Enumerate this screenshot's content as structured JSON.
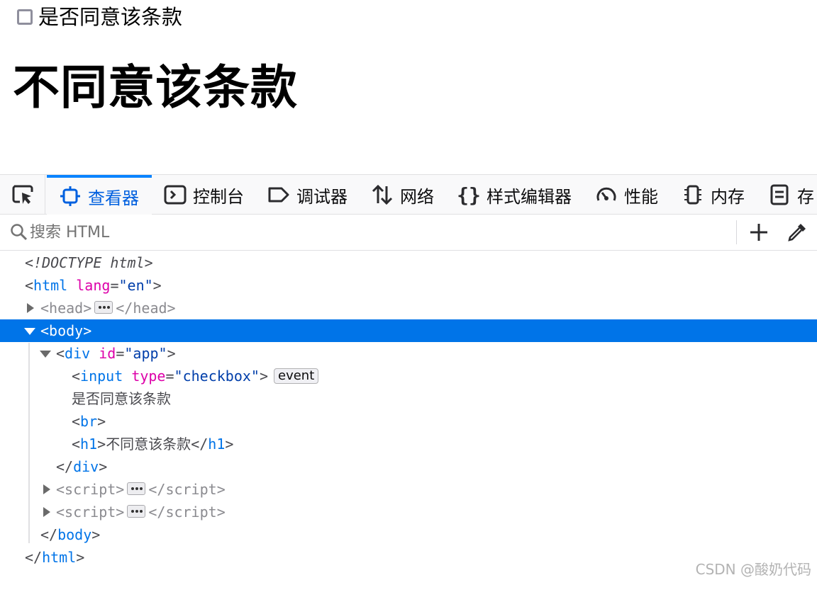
{
  "page": {
    "checkbox_label": "是否同意该条款",
    "heading": "不同意该条款"
  },
  "devtools": {
    "tabs": [
      {
        "label": "查看器",
        "icon": "inspector-icon",
        "selected": true
      },
      {
        "label": "控制台",
        "icon": "console-icon",
        "selected": false
      },
      {
        "label": "调试器",
        "icon": "debugger-icon",
        "selected": false
      },
      {
        "label": "网络",
        "icon": "network-icon",
        "selected": false
      },
      {
        "label": "样式编辑器",
        "icon": "style-editor-icon",
        "selected": false
      },
      {
        "label": "性能",
        "icon": "performance-icon",
        "selected": false
      },
      {
        "label": "内存",
        "icon": "memory-icon",
        "selected": false
      },
      {
        "label": "存",
        "icon": "storage-icon",
        "selected": false
      }
    ],
    "search": {
      "placeholder": "搜索 HTML",
      "value": ""
    },
    "accent_color": "#0074e8",
    "markup": {
      "doctype": "<!DOCTYPE html>",
      "html_tag": "html",
      "lang_attr": "lang",
      "lang_val": "\"en\"",
      "head_tag": "head",
      "body_tag": "body",
      "div_tag": "div",
      "id_attr": "id",
      "id_val": "\"app\"",
      "input_tag": "input",
      "type_attr": "type",
      "type_val": "\"checkbox\"",
      "event_badge": "event",
      "text_node": "是否同意该条款",
      "br_tag": "br",
      "h1_tag": "h1",
      "h1_text": "不同意该条款",
      "script_tag": "script"
    }
  },
  "watermark": "CSDN @酸奶代码"
}
